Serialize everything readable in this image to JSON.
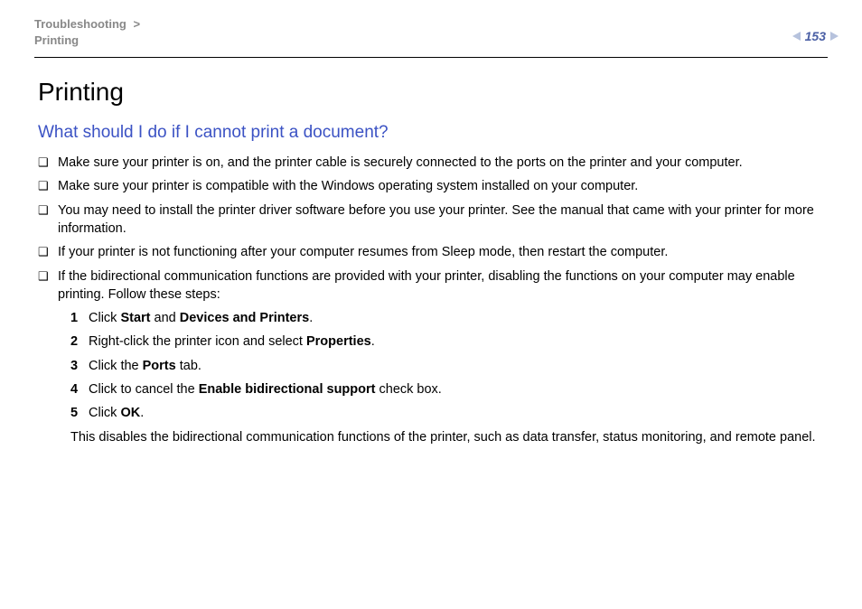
{
  "header": {
    "breadcrumb_line1": "Troubleshooting",
    "breadcrumb_sep": " >",
    "breadcrumb_line2": "Printing",
    "page_number": "153"
  },
  "content": {
    "title": "Printing",
    "subtitle": "What should I do if I cannot print a document?",
    "bullets": [
      "Make sure your printer is on, and the printer cable is securely connected to the ports on the printer and your computer.",
      "Make sure your printer is compatible with the Windows operating system installed on your computer.",
      "You may need to install the printer driver software before you use your printer. See the manual that came with your printer for more information.",
      "If your printer is not functioning after your computer resumes from Sleep mode, then restart the computer.",
      "If the bidirectional communication functions are provided with your printer, disabling the functions on your computer may enable printing. Follow these steps:"
    ],
    "steps": [
      {
        "n": "1",
        "pre": "Click ",
        "b1": "Start",
        "mid": " and ",
        "b2": "Devices and Printers",
        "post": "."
      },
      {
        "n": "2",
        "pre": "Right-click the printer icon and select ",
        "b1": "Properties",
        "mid": "",
        "b2": "",
        "post": "."
      },
      {
        "n": "3",
        "pre": "Click the ",
        "b1": "Ports",
        "mid": "",
        "b2": "",
        "post": " tab."
      },
      {
        "n": "4",
        "pre": "Click to cancel the ",
        "b1": "Enable bidirectional support",
        "mid": "",
        "b2": "",
        "post": " check box."
      },
      {
        "n": "5",
        "pre": "Click ",
        "b1": "OK",
        "mid": "",
        "b2": "",
        "post": "."
      }
    ],
    "trailing_note": "This disables the bidirectional communication functions of the printer, such as data transfer, status monitoring, and remote panel."
  }
}
